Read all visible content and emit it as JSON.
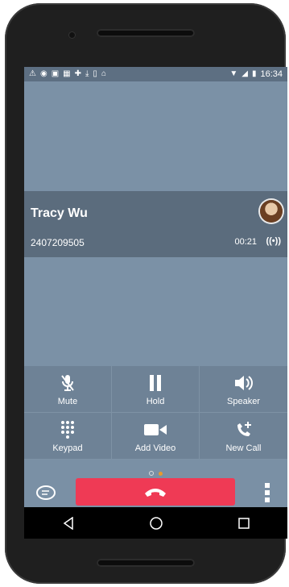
{
  "status_bar": {
    "time": "16:34",
    "left_icons": [
      "warning-icon",
      "voicemail-icon",
      "message-icon",
      "gallery-icon",
      "puzzle-icon",
      "download-icon",
      "download-box-icon",
      "briefcase-icon"
    ],
    "right_icons": [
      "wifi-icon",
      "signal-icon",
      "battery-icon"
    ]
  },
  "call": {
    "contact_name": "Tracy Wu",
    "number": "2407209505",
    "duration": "00:21",
    "audio_indicator": "((•))"
  },
  "controls": [
    {
      "label": "Mute",
      "icon": "mute-icon"
    },
    {
      "label": "Hold",
      "icon": "hold-icon"
    },
    {
      "label": "Speaker",
      "icon": "speaker-icon"
    },
    {
      "label": "Keypad",
      "icon": "keypad-icon"
    },
    {
      "label": "Add Video",
      "icon": "video-icon"
    },
    {
      "label": "New Call",
      "icon": "add-call-icon"
    }
  ],
  "colors": {
    "end_call": "#ef3a55",
    "page_dot_active": "#e79a2d"
  }
}
